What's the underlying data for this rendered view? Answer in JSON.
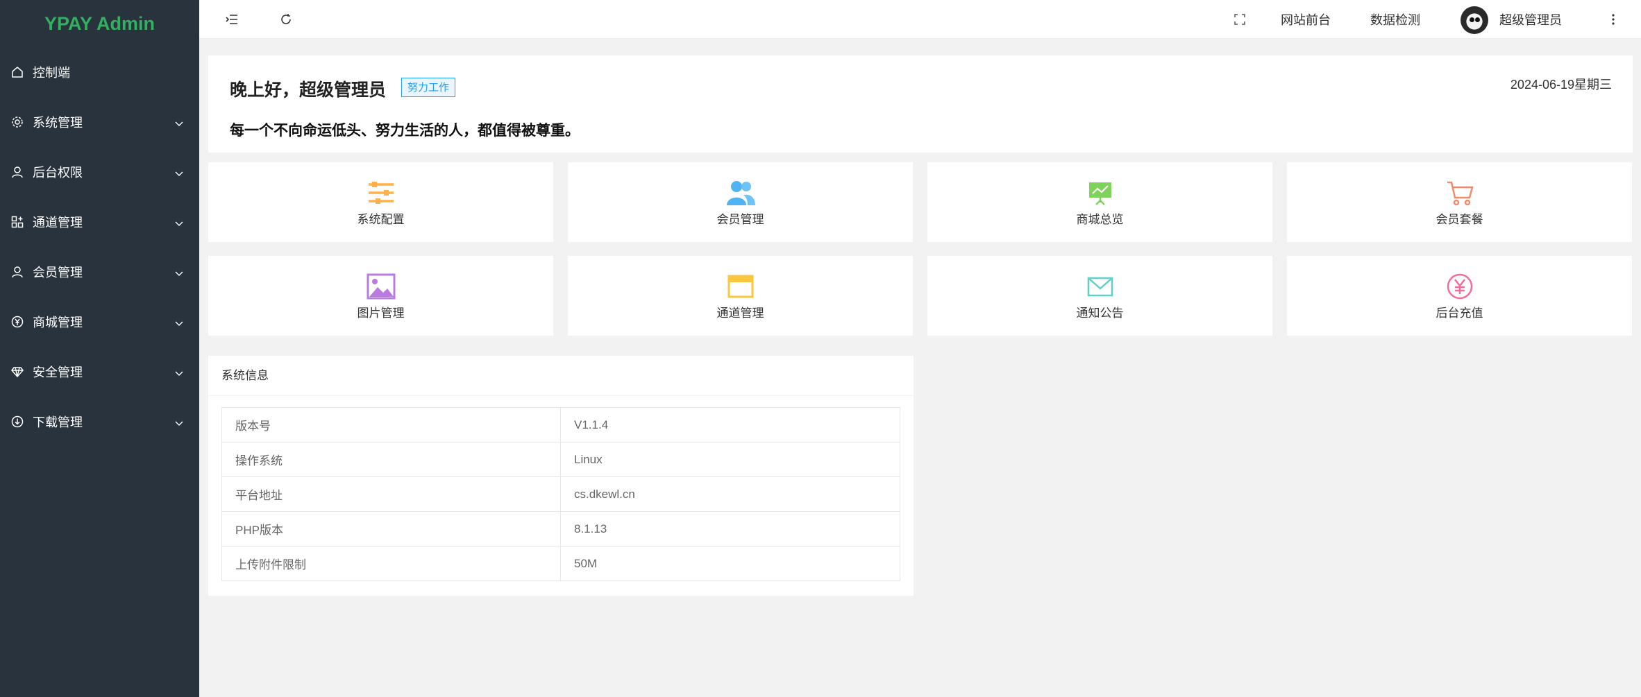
{
  "app": {
    "logo": "YPAY Admin"
  },
  "sidebar": {
    "items": [
      {
        "label": "控制端",
        "icon": "home-icon",
        "expandable": false
      },
      {
        "label": "系统管理",
        "icon": "gear-icon",
        "expandable": true
      },
      {
        "label": "后台权限",
        "icon": "user-icon",
        "expandable": true
      },
      {
        "label": "通道管理",
        "icon": "apps-icon",
        "expandable": true
      },
      {
        "label": "会员管理",
        "icon": "user-icon",
        "expandable": true
      },
      {
        "label": "商城管理",
        "icon": "yen-circle-icon",
        "expandable": true
      },
      {
        "label": "安全管理",
        "icon": "diamond-icon",
        "expandable": true
      },
      {
        "label": "下载管理",
        "icon": "download-circle-icon",
        "expandable": true
      }
    ]
  },
  "header": {
    "links": {
      "frontend": "网站前台",
      "data_check": "数据检测"
    },
    "user_name": "超级管理员"
  },
  "welcome": {
    "greeting": "晚上好，超级管理员",
    "badge": "努力工作",
    "date": "2024-06-19星期三",
    "motto": "每一个不向命运低头、努力生活的人，都值得被尊重。"
  },
  "quick_links": [
    {
      "label": "系统配置",
      "icon": "sliders-icon",
      "color": "#ffb04a"
    },
    {
      "label": "会员管理",
      "icon": "users-icon",
      "color": "#4fb3f6"
    },
    {
      "label": "商城总览",
      "icon": "presentation-icon",
      "color": "#7fd35a"
    },
    {
      "label": "会员套餐",
      "icon": "cart-icon",
      "color": "#f28b6a"
    },
    {
      "label": "图片管理",
      "icon": "image-icon",
      "color": "#b97be0"
    },
    {
      "label": "通道管理",
      "icon": "browser-window-icon",
      "color": "#f9c640"
    },
    {
      "label": "通知公告",
      "icon": "mail-icon",
      "color": "#5fd0c8"
    },
    {
      "label": "后台充值",
      "icon": "yen-circle-icon",
      "color": "#f56c9c"
    }
  ],
  "system_info": {
    "title": "系统信息",
    "rows": [
      {
        "key": "版本号",
        "value": "V1.1.4"
      },
      {
        "key": "操作系统",
        "value": "Linux"
      },
      {
        "key": "平台地址",
        "value": "cs.dkewl.cn"
      },
      {
        "key": "PHP版本",
        "value": "8.1.13"
      },
      {
        "key": "上传附件限制",
        "value": "50M"
      }
    ]
  }
}
